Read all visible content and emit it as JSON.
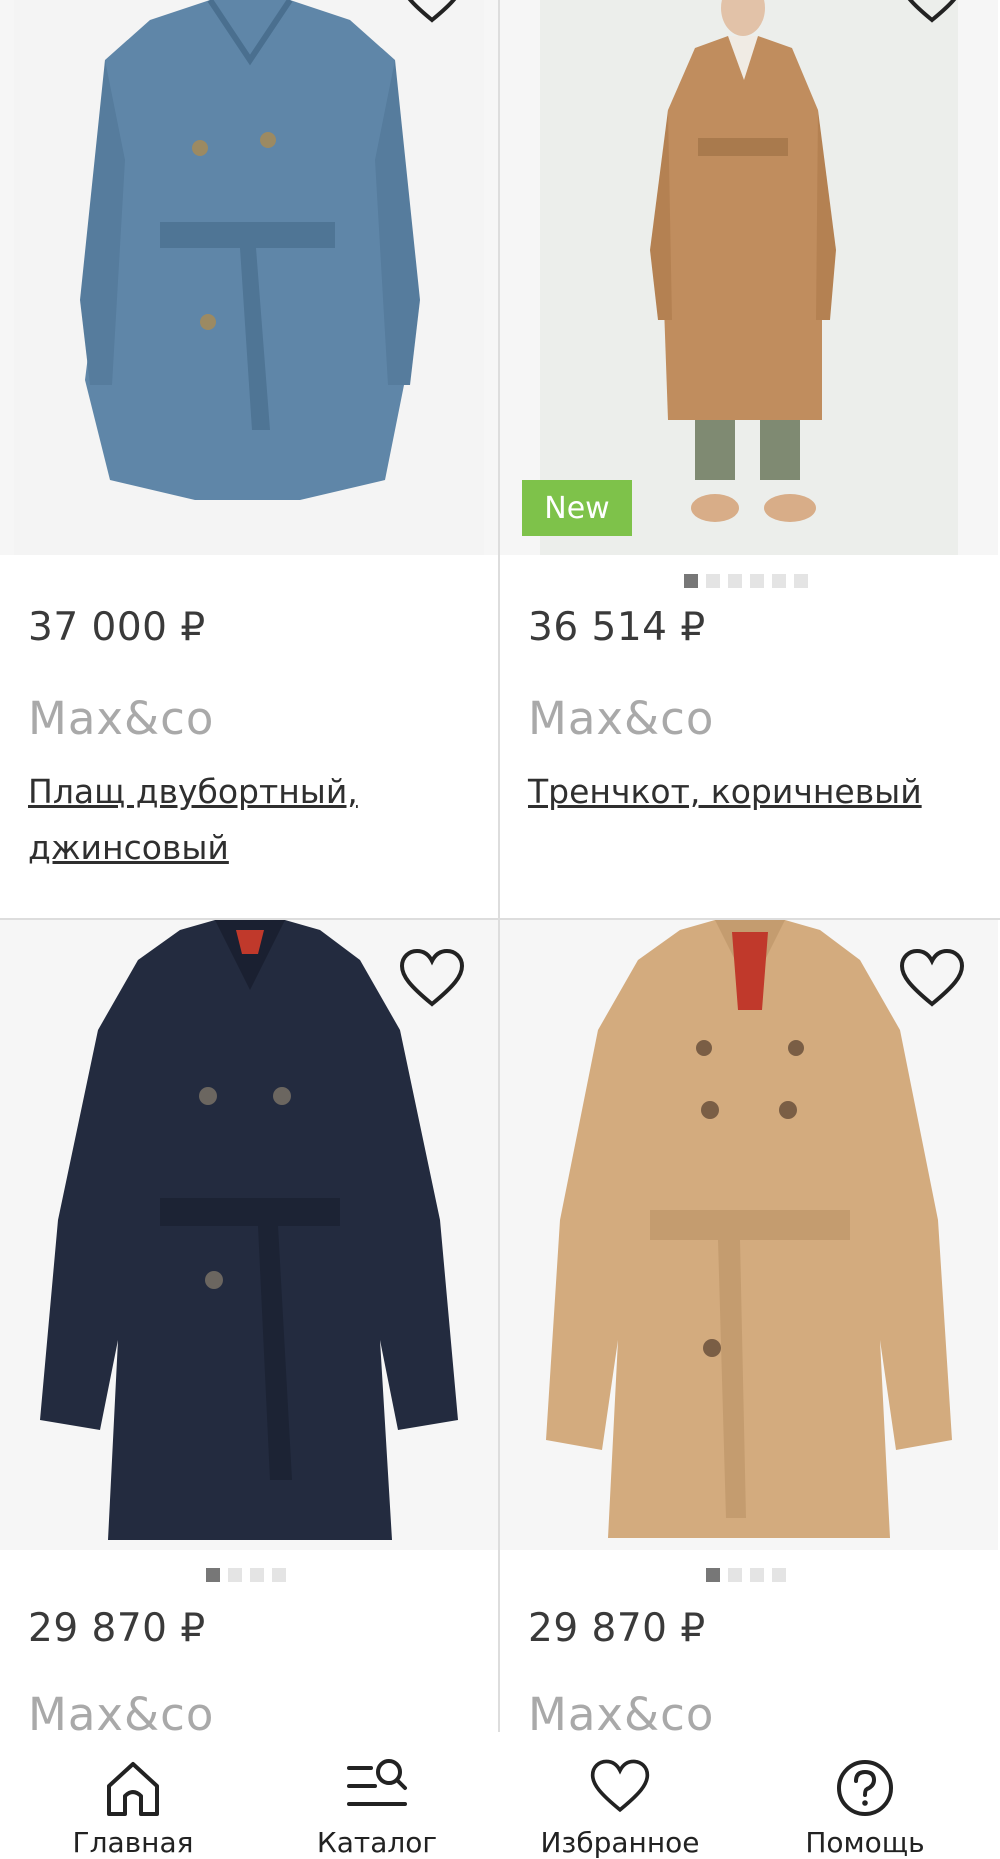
{
  "products": [
    {
      "price": "37 000 ₽",
      "brand": "Max&co",
      "title": "Плащ двубортный, джинсовый",
      "color": "#5f86a8",
      "icon": "heart-outline-icon"
    },
    {
      "price": "36 514 ₽",
      "brand": "Max&co",
      "title": "Тренчкот, коричневый",
      "badge": "New",
      "color": "#c08d5e",
      "image_count": 6,
      "active_image": 1,
      "icon": "heart-outline-icon"
    },
    {
      "price": "29 870 ₽",
      "brand": "Max&co",
      "title": "",
      "color": "#232b3f",
      "image_count": 4,
      "active_image": 1,
      "icon": "heart-outline-icon"
    },
    {
      "price": "29 870 ₽",
      "brand": "Max&co",
      "title": "",
      "color": "#d3ab7e",
      "image_count": 4,
      "active_image": 1,
      "icon": "heart-outline-icon"
    }
  ],
  "tabbar": [
    {
      "label": "Главная",
      "icon": "home-icon"
    },
    {
      "label": "Каталог",
      "icon": "catalog-search-icon"
    },
    {
      "label": "Избранное",
      "icon": "heart-icon"
    },
    {
      "label": "Помощь",
      "icon": "help-icon"
    }
  ],
  "colors": {
    "badge_new": "#7ec24a",
    "divider": "#dddddd",
    "brand_text": "#a9a9a9"
  }
}
